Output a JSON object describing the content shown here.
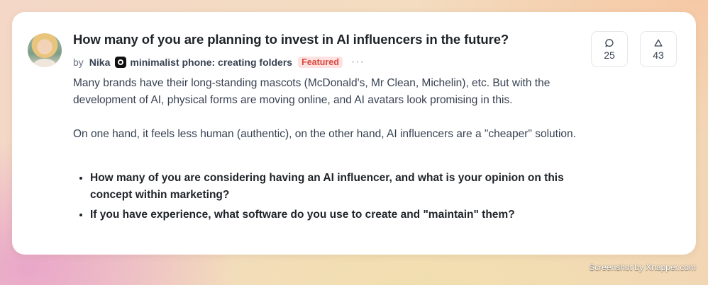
{
  "post": {
    "title": "How many of you are planning to invest in AI influencers in the future?",
    "by_label": "by",
    "author": "Nika",
    "product": "minimalist phone: creating folders",
    "badge": "Featured",
    "more": "···",
    "paragraphs": [
      "Many brands have their long-standing mascots (McDonald's, Mr Clean, Michelin), etc. But with the development of AI, physical forms are moving online, and AI avatars look promising in this.",
      "On one hand, it feels less human (authentic), on the other hand, AI influencers are a \"cheaper\" solution."
    ],
    "bullets": [
      "How many of you are considering having an AI influencer, and what is your opinion on this concept within marketing?",
      "If you have experience, what software do you use to create and \"maintain\" them?"
    ]
  },
  "stats": {
    "comments": "25",
    "upvotes": "43"
  },
  "watermark": "Screenshot by Xnapper.com"
}
